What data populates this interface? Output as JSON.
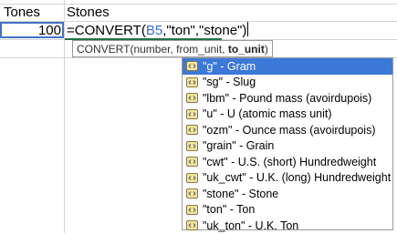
{
  "sheet": {
    "header_tones": "Tones",
    "header_stones": "Stones",
    "cell_value": "100",
    "formula_prefix": "=CONVERT(",
    "formula_ref": "B5",
    "formula_suffix": ",\"ton\",\"stone\")"
  },
  "tooltip": {
    "signature_start": "CONVERT(number, from_unit, ",
    "signature_bold": "to_unit",
    "signature_end": ")"
  },
  "dropdown": {
    "items": [
      {
        "code": "\"g\"",
        "desc": " - Gram"
      },
      {
        "code": "\"sg\"",
        "desc": " - Slug"
      },
      {
        "code": "\"lbm\"",
        "desc": " - Pound mass (avoirdupois)"
      },
      {
        "code": "\"u\"",
        "desc": " - U (atomic mass unit)"
      },
      {
        "code": "\"ozm\"",
        "desc": " - Ounce mass (avoirdupois)"
      },
      {
        "code": "\"grain\"",
        "desc": " - Grain"
      },
      {
        "code": "\"cwt\"",
        "desc": " - U.S. (short) Hundredweight"
      },
      {
        "code": "\"uk_cwt\"",
        "desc": " - U.K. (long) Hundredweight"
      },
      {
        "code": "\"stone\"",
        "desc": " - Stone"
      },
      {
        "code": "\"ton\"",
        "desc": " - Ton"
      },
      {
        "code": "\"uk_ton\"",
        "desc": " - U.K. Ton"
      }
    ],
    "selected_index": 0,
    "item_icon": "unit-list-icon"
  },
  "colors": {
    "selection": "#3c78d8",
    "reference": "#3a6fd1",
    "active_border": "#4472c4",
    "edit_underline": "#217346"
  }
}
